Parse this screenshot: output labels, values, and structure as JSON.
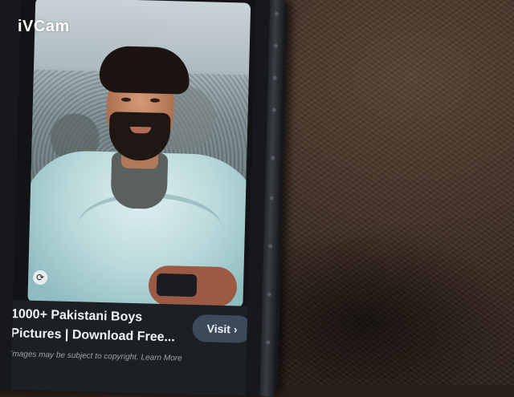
{
  "watermark": "iVCam",
  "pin": {
    "title": "1000+ Pakistani Boys\nPictures | Download Free...",
    "visit_label": "Visit",
    "visit_icon": "chevron-right-icon",
    "caption": "Images may be subject to copyright. Learn More",
    "lens_icon": "visual-search-icon"
  },
  "colors": {
    "card_bg": "#1c2024",
    "visit_bg": "#3d4a5c",
    "table": "#3c2c22"
  }
}
